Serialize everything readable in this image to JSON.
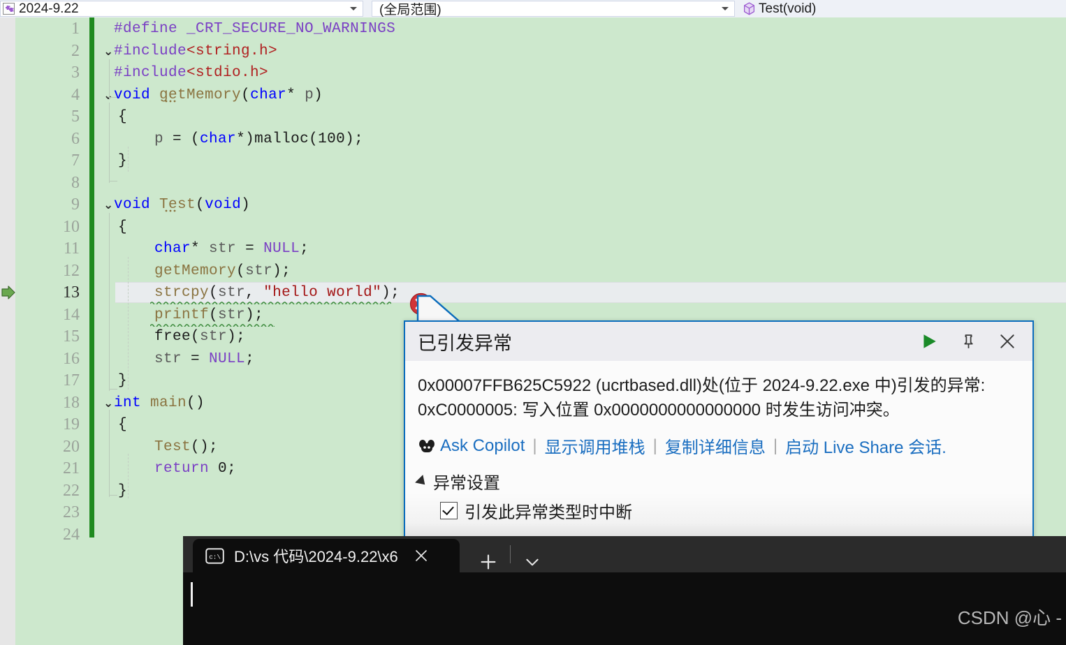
{
  "topbar": {
    "file_combo": {
      "value": "2024-9.22",
      "icon": "cpp-file-icon"
    },
    "scope_combo": {
      "value": "(全局范围)"
    },
    "member_combo": {
      "value": "Test(void)",
      "icon": "cube-icon"
    }
  },
  "editor": {
    "background": "#cde8cd",
    "change_bar_color": "#1f8a1f",
    "current_line": 13,
    "line_numbers": [
      1,
      2,
      3,
      4,
      5,
      6,
      7,
      8,
      9,
      10,
      11,
      12,
      13,
      14,
      15,
      16,
      17,
      18,
      19,
      20,
      21,
      22,
      23,
      24
    ],
    "lines": [
      {
        "n": 1,
        "text": "#define _CRT_SECURE_NO_WARNINGS"
      },
      {
        "n": 2,
        "text": "#include<string.h>"
      },
      {
        "n": 3,
        "text": "#include<stdio.h>"
      },
      {
        "n": 4,
        "text": "void getMemory(char* p)"
      },
      {
        "n": 5,
        "text": "{"
      },
      {
        "n": 6,
        "text": "    p = (char*)malloc(100);"
      },
      {
        "n": 7,
        "text": "}"
      },
      {
        "n": 8,
        "text": ""
      },
      {
        "n": 9,
        "text": "void Test(void)"
      },
      {
        "n": 10,
        "text": "{"
      },
      {
        "n": 11,
        "text": "    char* str = NULL;"
      },
      {
        "n": 12,
        "text": "    getMemory(str);"
      },
      {
        "n": 13,
        "text": "    strcpy(str, \"hello world\");"
      },
      {
        "n": 14,
        "text": "    printf(str);"
      },
      {
        "n": 15,
        "text": "    free(str);"
      },
      {
        "n": 16,
        "text": "    str = NULL;"
      },
      {
        "n": 17,
        "text": "}"
      },
      {
        "n": 18,
        "text": "int main()"
      },
      {
        "n": 19,
        "text": "{"
      },
      {
        "n": 20,
        "text": "    Test();"
      },
      {
        "n": 21,
        "text": "    return 0;"
      },
      {
        "n": 22,
        "text": "}"
      },
      {
        "n": 23,
        "text": ""
      },
      {
        "n": 24,
        "text": ""
      }
    ],
    "margin_marker": "execution-pointer-arrow",
    "error_marker": "error-icon"
  },
  "dialog": {
    "title": "已引发异常",
    "message": "0x00007FFB625C5922 (ucrtbased.dll)处(位于 2024-9.22.exe 中)引发的异常: 0xC0000005: 写入位置 0x0000000000000000 时发生访问冲突。",
    "links": [
      {
        "label": "Ask Copilot",
        "icon": "copilot-icon"
      },
      {
        "label": "显示调用堆栈"
      },
      {
        "label": "复制详细信息"
      },
      {
        "label": "启动 Live Share 会话."
      }
    ],
    "link_separator": "|",
    "settings_label": "异常设置",
    "checkbox_label": "引发此异常类型时中断",
    "checkbox_checked": "true",
    "actions": [
      {
        "name": "continue-button",
        "icon": "play-icon"
      },
      {
        "name": "pin-button",
        "icon": "pin-icon"
      },
      {
        "name": "close-button",
        "icon": "close-icon"
      }
    ],
    "border_color": "#0a6cbc",
    "link_color": "#1a6ec0"
  },
  "terminal": {
    "tab_label": "D:\\vs 代码\\2024-9.22\\x6",
    "tab_icon": "console-icon",
    "close_label": "×",
    "new_tab_label": "+",
    "dropdown_label": "⌄",
    "prompt": "",
    "background": "#0d0d0d"
  },
  "watermark": {
    "text": "CSDN @心 -"
  }
}
